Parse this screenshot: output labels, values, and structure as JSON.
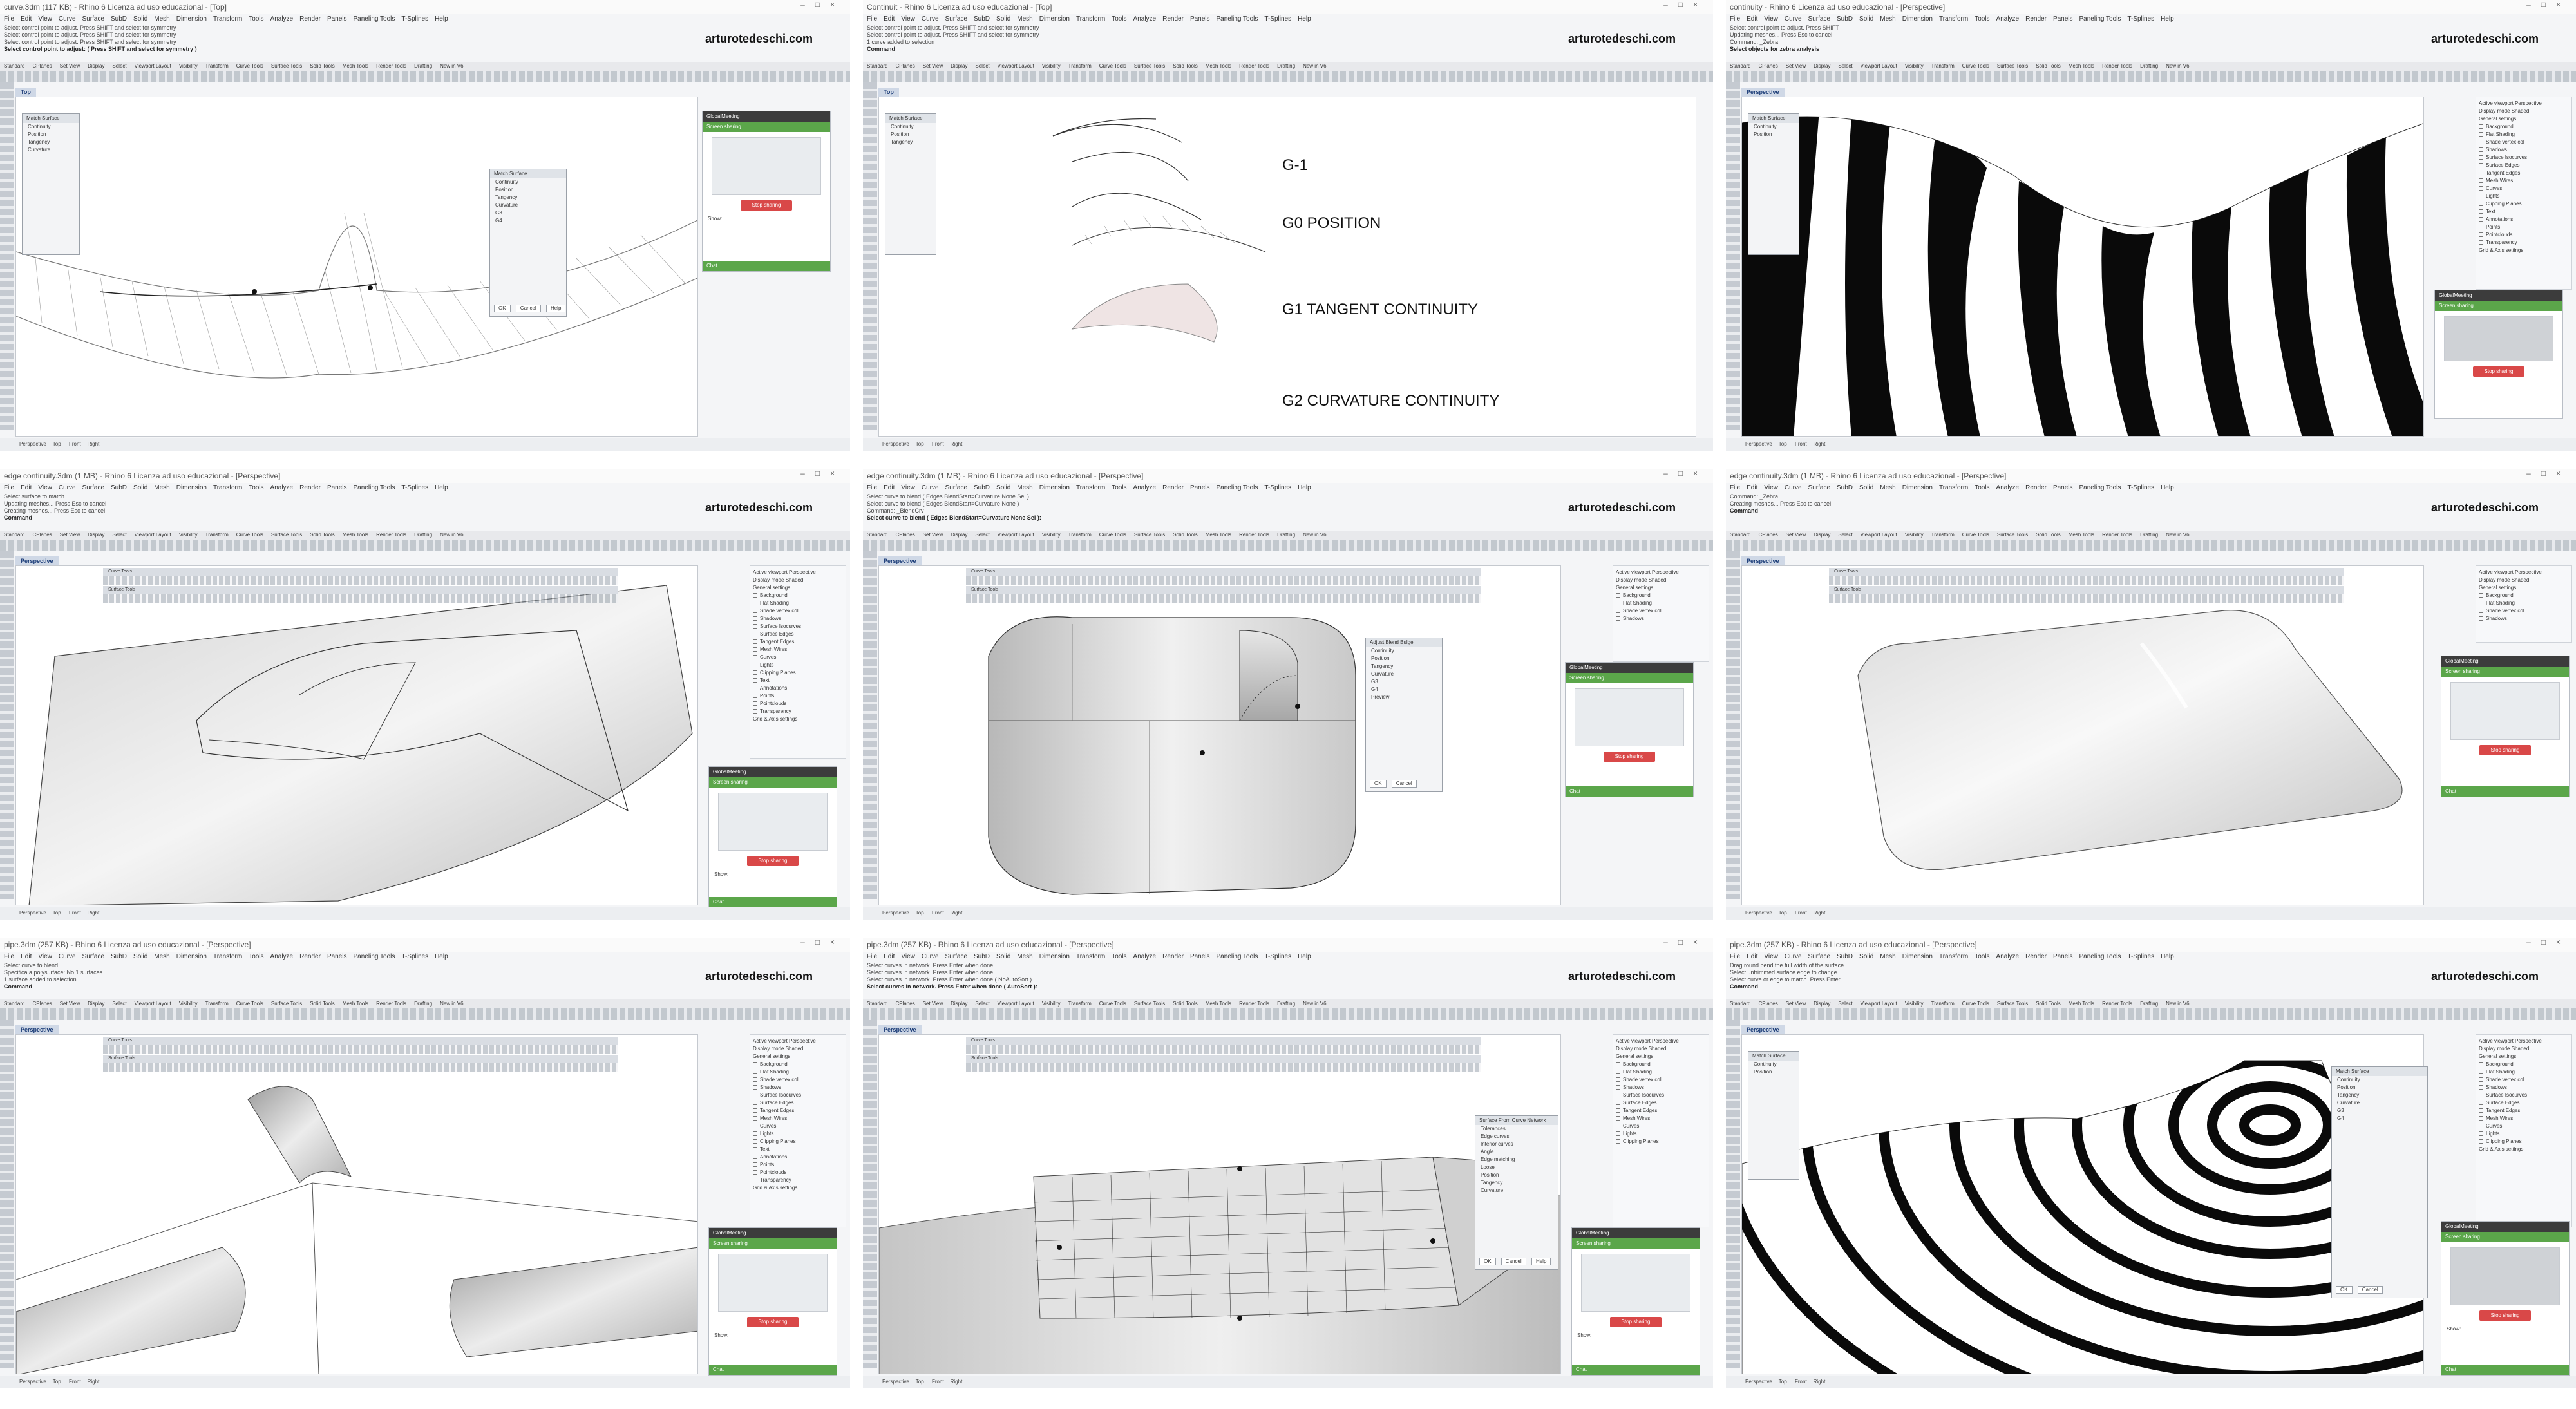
{
  "brand": "arturotedeschi.com",
  "menu": [
    "File",
    "Edit",
    "View",
    "Curve",
    "Surface",
    "SubD",
    "Solid",
    "Mesh",
    "Dimension",
    "Transform",
    "Tools",
    "Analyze",
    "Render",
    "Panels",
    "Paneling Tools",
    "T-Splines",
    "Help"
  ],
  "tabs": [
    "Standard",
    "CPlanes",
    "Set View",
    "Display",
    "Select",
    "Viewport Layout",
    "Visibility",
    "Transform",
    "Curve Tools",
    "Surface Tools",
    "Solid Tools",
    "Mesh Tools",
    "Render Tools",
    "Drafting",
    "New in V6"
  ],
  "status_tabs": [
    "Perspective",
    "Top",
    "Front",
    "Right"
  ],
  "toolbar_labels": {
    "curve_tools": "Curve Tools",
    "surface_tools": "Surface Tools"
  },
  "share": {
    "title": "GlobalMeeting",
    "screen_sharing": "Screen sharing",
    "stop_sharing": "Stop sharing",
    "show": "Show:",
    "chat": "Chat"
  },
  "panels": [
    {
      "title": "curve.3dm (117 KB) - Rhino 6 Licenza ad uso educazional - [Top]",
      "cmd_lines": [
        "Select control point to adjust. Press SHIFT and select for symmetry",
        "Select control point to adjust. Press SHIFT and select for symmetry",
        "Select control point to adjust. Press SHIFT and select for symmetry",
        "Select control point to adjust: ( Press SHIFT and select for symmetry )"
      ],
      "vp_tab": "Top"
    },
    {
      "title": "Continuit - Rhino 6 Licenza ad uso educazional - [Top]",
      "cmd_lines": [
        "Select control point to adjust. Press SHIFT and select for symmetry",
        "Select control point to adjust. Press SHIFT and select for symmetry",
        "1 curve added to selection",
        "Command"
      ],
      "vp_tab": "Top",
      "labels": [
        "G-1",
        "G0 POSITION",
        "G1 TANGENT CONTINUITY",
        "G2 CURVATURE CONTINUITY"
      ]
    },
    {
      "title": "continuity - Rhino 6 Licenza ad uso educazional - [Perspective]",
      "cmd_lines": [
        "Select control point to adjust. Press SHIFT",
        "Updating meshes... Press Esc to cancel",
        "Command: _Zebra",
        "Select objects for zebra analysis"
      ],
      "vp_tab": "Perspective"
    },
    {
      "title": "edge continuity.3dm (1 MB) - Rhino 6 Licenza ad uso educazional - [Perspective]",
      "cmd_lines": [
        "Select surface to match",
        "Updating meshes... Press Esc to cancel",
        "Creating meshes... Press Esc to cancel",
        "Command"
      ],
      "vp_tab": "Perspective"
    },
    {
      "title": "edge continuity.3dm (1 MB) - Rhino 6 Licenza ad uso educazional - [Perspective]",
      "cmd_lines": [
        "Select curve to blend ( Edges  BlendStart=Curvature  None Sel )",
        "Select curve to blend ( Edges  BlendStart=Curvature  None )",
        "Command: _BlendCrv",
        "Select curve to blend ( Edges  BlendStart=Curvature  None Sel ):"
      ],
      "vp_tab": "Perspective"
    },
    {
      "title": "edge continuity.3dm (1 MB) - Rhino 6 Licenza ad uso educazional - [Perspective]",
      "cmd_lines": [
        "Command: _Zebra",
        "Creating meshes... Press Esc to cancel",
        "Command"
      ],
      "vp_tab": "Perspective"
    },
    {
      "title": "pipe.3dm (257 KB) - Rhino 6 Licenza ad uso educazional - [Perspective]",
      "cmd_lines": [
        "Select curve to blend",
        "Specifica a polysurface: No 1 surfaces",
        "1 surface added to selection",
        "Command"
      ],
      "vp_tab": "Perspective"
    },
    {
      "title": "pipe.3dm (257 KB) - Rhino 6 Licenza ad uso educazional - [Perspective]",
      "cmd_lines": [
        "Select curves in network. Press Enter when done",
        "Select curves in network. Press Enter when done",
        "Select curves in network. Press Enter when done ( NoAutoSort )",
        "Select curves in network. Press Enter when done ( AutoSort ):"
      ],
      "vp_tab": "Perspective"
    },
    {
      "title": "pipe.3dm (257 KB) - Rhino 6 Licenza ad uso educazional - [Perspective]",
      "cmd_lines": [
        "Drag round bend the full width of the surface",
        "Select untrimmed surface edge to change",
        "Select curve or edge to match. Press Enter",
        "Command"
      ],
      "vp_tab": "Perspective"
    }
  ],
  "dialogs": {
    "match_surface": {
      "title": "Match Surface",
      "lines": [
        "Continuity",
        "Position",
        "Tangency",
        "Curvature",
        "G3",
        "G4"
      ],
      "ok": "OK",
      "cancel": "Cancel",
      "help": "Help"
    },
    "surface_from_network": {
      "title": "Surface From Curve Network",
      "lines": [
        "Tolerances",
        "Edge curves",
        "Interior curves",
        "Angle",
        "Edge matching",
        "Loose",
        "Position",
        "Tangency",
        "Curvature"
      ],
      "ok": "OK",
      "cancel": "Cancel",
      "help": "Help"
    },
    "blend_surface": {
      "title": "Adjust Blend Bulge",
      "lines": [
        "Continuity",
        "Position",
        "Tangency",
        "Curvature",
        "G3",
        "G4",
        "Preview"
      ],
      "ok": "OK",
      "cancel": "Cancel"
    }
  },
  "props": [
    "Active viewport",
    "Display mode",
    "General settings",
    "Background",
    "Color",
    "Flat Shading",
    "Shade vertex col",
    "Shadows",
    "Surface Isocurves",
    "Surface Edges",
    "Tangent Edges",
    "Mesh Wires",
    "Curves",
    "Lights",
    "Clipping Planes",
    "Text",
    "Annotations",
    "Points",
    "Pointclouds",
    "Transparency",
    "Grid & Axis settings"
  ],
  "props_values": {
    "viewport": "Perspective",
    "display_mode": "Shaded"
  }
}
